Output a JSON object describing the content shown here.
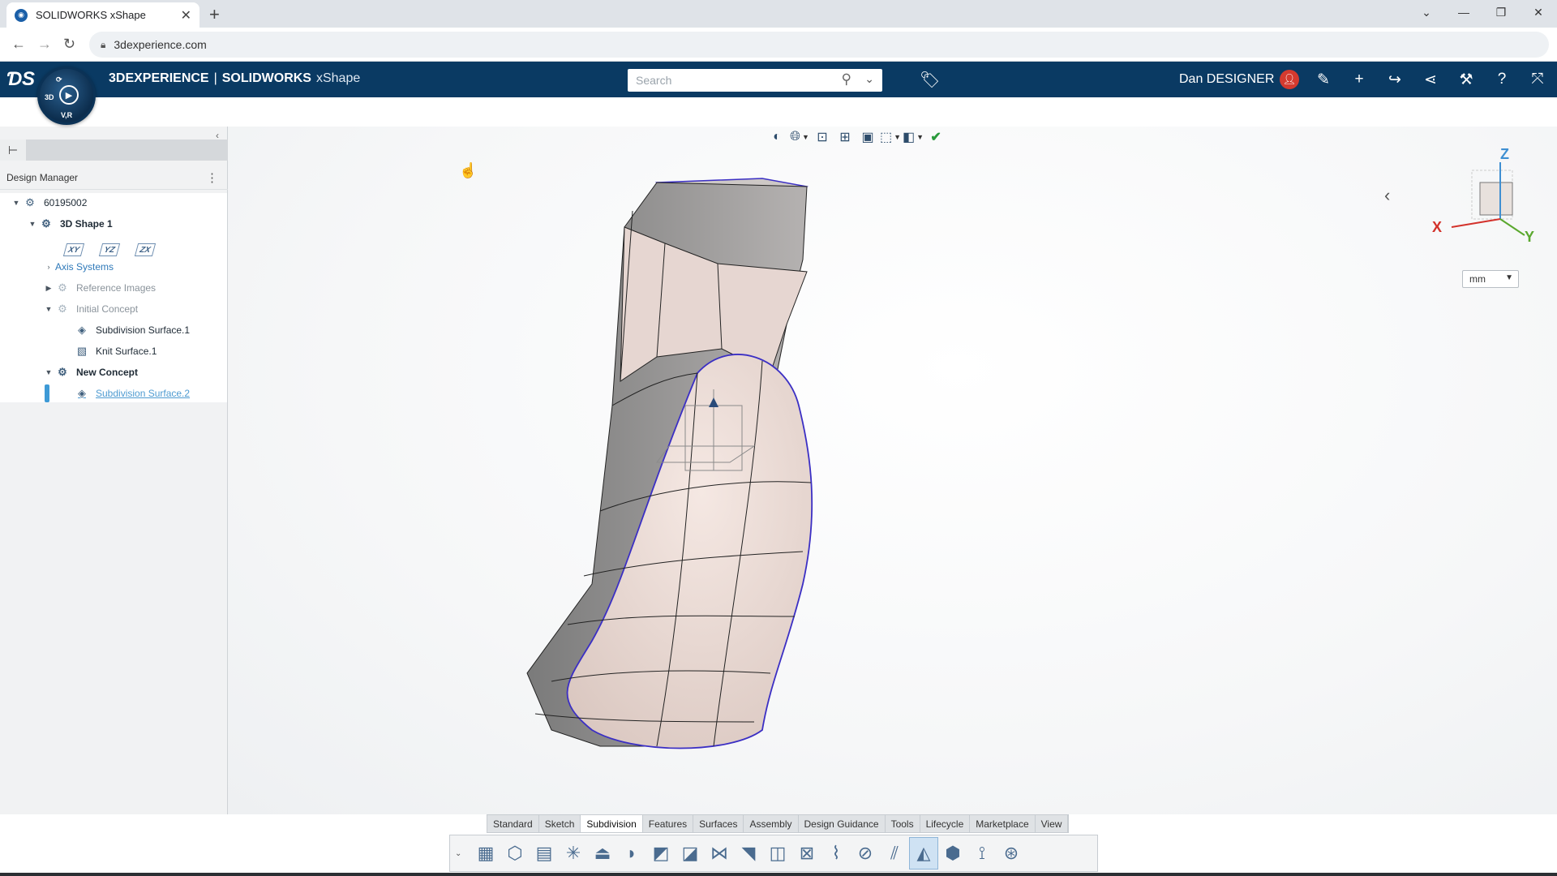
{
  "browser": {
    "tab_title": "SOLIDWORKS xShape",
    "tab_close": "✕",
    "new_tab": "+",
    "url": "3dexperience.com",
    "window_controls": [
      "⌄",
      "—",
      "❐",
      "✕"
    ]
  },
  "app": {
    "brand_bold": "3DEXPERIENCE",
    "separator": "|",
    "brand_product": "SOLIDWORKS",
    "brand_app": "xShape",
    "search_placeholder": "Search",
    "user_name": "Dan DESIGNER",
    "compass_labels": {
      "top": "3D",
      "bottom": "V,R"
    }
  },
  "left_panel": {
    "header": "Design Manager",
    "tree": [
      {
        "label": "60195002",
        "level": 0,
        "expanded": true,
        "style": "normal"
      },
      {
        "label": "3D Shape 1",
        "level": 1,
        "expanded": true,
        "style": "bold"
      },
      {
        "label": "Axis Systems",
        "level": 2,
        "expanded": false,
        "style": "link"
      },
      {
        "label": "Reference Images",
        "level": 2,
        "expanded": false,
        "style": "muted"
      },
      {
        "label": "Initial Concept",
        "level": 2,
        "expanded": true,
        "style": "muted"
      },
      {
        "label": "Subdivision Surface.1",
        "level": 3,
        "style": "normal"
      },
      {
        "label": "Knit Surface.1",
        "level": 3,
        "style": "normal"
      },
      {
        "label": "New Concept",
        "level": 2,
        "expanded": true,
        "style": "bold"
      },
      {
        "label": "Subdivision Surface.2",
        "level": 3,
        "style": "selected"
      }
    ],
    "planes": [
      "XY",
      "YZ",
      "ZX"
    ]
  },
  "viewport": {
    "triad_axes": {
      "x": "X",
      "y": "Y",
      "z": "Z"
    },
    "unit": "mm",
    "colors": {
      "x": "#d3322b",
      "y": "#5aa82e",
      "z": "#3f8fd2"
    }
  },
  "action_bar": {
    "tabs": [
      "Standard",
      "Sketch",
      "Subdivision",
      "Features",
      "Surfaces",
      "Assembly",
      "Design Guidance",
      "Tools",
      "Lifecycle",
      "Marketplace",
      "View"
    ],
    "active_tab": "Subdivision"
  },
  "colors": {
    "topbar": "#0a3a63",
    "surface_fill": "#ecdcd6",
    "surface_edge": "#3b2fc4"
  }
}
